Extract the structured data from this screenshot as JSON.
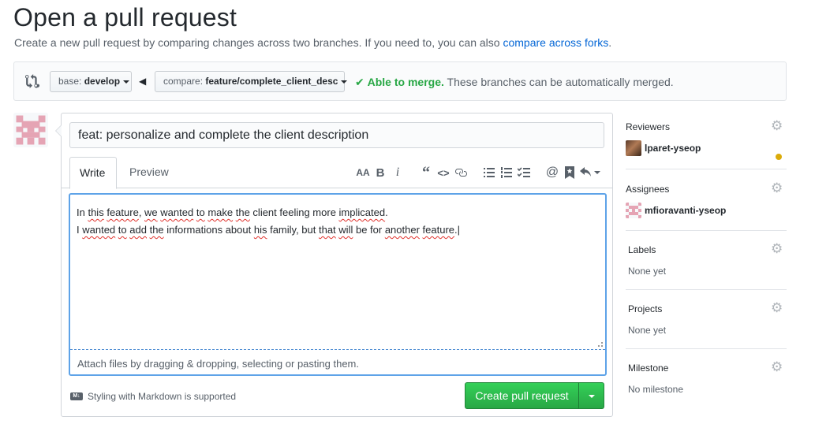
{
  "page": {
    "title": "Open a pull request",
    "subtitle_text": "Create a new pull request by comparing changes across two branches. If you need to, you can also ",
    "subtitle_link": "compare across forks",
    "subtitle_end": "."
  },
  "range": {
    "base_prefix": "base:",
    "base_value": "develop",
    "compare_prefix": "compare:",
    "compare_value": "feature/complete_client_desc",
    "merge_ok": "Able to merge.",
    "merge_text": "These branches can be automatically merged."
  },
  "form": {
    "title_value": "feat: personalize and complete the client description",
    "tab_write": "Write",
    "tab_preview": "Preview",
    "toolbar_icons": [
      "text-size-icon",
      "bold-icon",
      "italic-icon",
      "quote-icon",
      "code-icon",
      "link-icon",
      "unordered-list-icon",
      "ordered-list-icon",
      "task-list-icon",
      "mention-icon",
      "bookmark-icon",
      "reply-icon"
    ],
    "body_line1": "In this feature, we wanted to make the client feeling more implicated.",
    "body_line2": "I wanted to add the informations about his family, but that will be for another feature.",
    "attach_text": "Attach files by dragging & dropping, selecting or pasting them.",
    "markdown_note": "Styling with Markdown is supported",
    "markdown_badge": "M↓",
    "create_label": "Create pull request"
  },
  "sidebar": {
    "reviewers_label": "Reviewers",
    "reviewer_name": "lparet-yseop",
    "assignees_label": "Assignees",
    "assignee_name": "mfioravanti-yseop",
    "labels_label": "Labels",
    "labels_value": "None yet",
    "projects_label": "Projects",
    "projects_value": "None yet",
    "milestone_label": "Milestone",
    "milestone_value": "No milestone"
  },
  "colors": {
    "link": "#0366d6",
    "merge_ok": "#28a745",
    "create_button": "#2cbe4e",
    "editor_focus": "#5ea3e8",
    "pending_review_dot": "#dbab09",
    "identicon": "#e5a4b4"
  }
}
